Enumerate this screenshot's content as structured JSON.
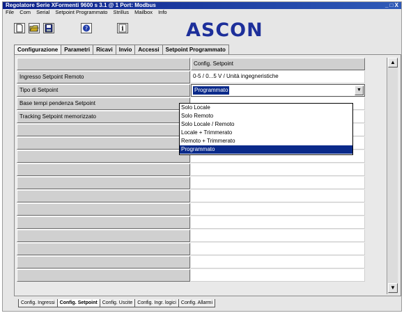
{
  "window": {
    "title": "Regolatore Serie XFormenti 9600 s 3.1 @ 1 Port: Modbus",
    "controls": "_ □ X"
  },
  "menu": [
    "File",
    "Com",
    "Serial",
    "Setpoint Programmato",
    "Strillus",
    "Mailbox",
    "Info"
  ],
  "toolbar": {
    "buttons": [
      "new-icon",
      "open-icon",
      "save-icon",
      "help-icon",
      "info-icon"
    ],
    "logo": "ASCON"
  },
  "tabs": [
    {
      "label": "Configurazione",
      "active": true
    },
    {
      "label": "Parametri",
      "active": false
    },
    {
      "label": "Ricavi",
      "active": false
    },
    {
      "label": "Invio",
      "active": false
    },
    {
      "label": "Accessi",
      "active": false
    },
    {
      "label": "Setpoint Programmato",
      "active": false
    }
  ],
  "grid": {
    "header": "Config. Setpoint",
    "rows": [
      {
        "label": "Ingresso Setpoint Remoto",
        "value": "0-5 / 0...5 V / Unità ingegneristiche"
      },
      {
        "label": "Tipo di Setpoint",
        "value": "Programmato"
      },
      {
        "label": "Base tempi pendenza Setpoint",
        "value": ""
      },
      {
        "label": "Tracking Setpoint memorizzato",
        "value": ""
      }
    ],
    "empty_rows": 12
  },
  "dropdown": {
    "options": [
      "Solo Locale",
      "Solo Remoto",
      "Solo Locale / Remoto",
      "Locale + Trimmerato",
      "Remoto + Trimmerato",
      "Programmato"
    ],
    "selected_index": 5
  },
  "sheet_tabs": [
    {
      "label": "Config. Ingressi",
      "active": false
    },
    {
      "label": "Config. Setpoint",
      "active": true
    },
    {
      "label": "Config. Uscite",
      "active": false
    },
    {
      "label": "Config. Ingr. logici",
      "active": false
    },
    {
      "label": "Config. Allarmi",
      "active": false
    }
  ],
  "colors": {
    "title_bar": "#0a1f8a",
    "selection": "#0a2a8a",
    "logo": "#1d2f9a"
  }
}
